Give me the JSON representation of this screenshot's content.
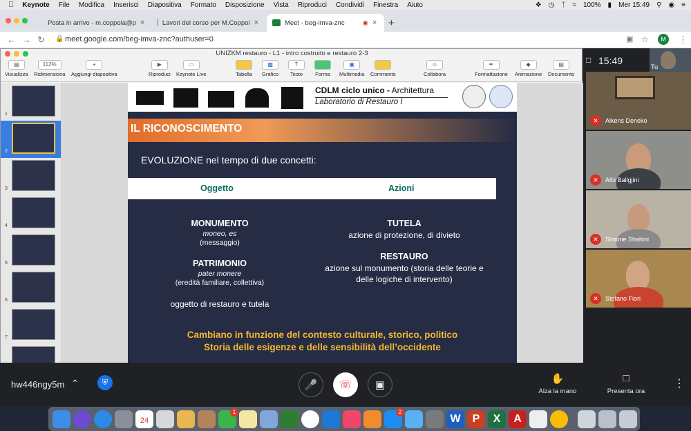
{
  "menubar": {
    "app": "Keynote",
    "items": [
      "File",
      "Modifica",
      "Inserisci",
      "Diapositiva",
      "Formato",
      "Disposizione",
      "Vista",
      "Riproduci",
      "Condividi",
      "Finestra",
      "Aiuto"
    ],
    "battery": "100%",
    "datetime": "Mer 15:49"
  },
  "browser": {
    "tabs": [
      {
        "title": "Posta in arrivo - m.coppola@p",
        "color": "#d93025"
      },
      {
        "title": "Lavori del corso per M.Coppol",
        "color": "#7e57c2"
      },
      {
        "title": "Meet - beg-imva-znc",
        "color": "#188038"
      }
    ],
    "url": "meet.google.com/beg-imva-znc?authuser=0",
    "profile_initial": "M"
  },
  "keynote": {
    "window_title": "UNIZKM restauro - L1 - intro costruito e restauro 2-3",
    "toolbar": {
      "view": "Visualizza",
      "zoom_value": "112%",
      "zoom": "Ridimensiona",
      "add_slide": "Aggiungi diapositiva",
      "play": "Riproduci",
      "keynote_live": "Keynote Live",
      "table": "Tabella",
      "chart": "Grafico",
      "text": "Testo",
      "shape": "Forma",
      "media": "Multimedia",
      "comment": "Commento",
      "collaborate": "Collabora",
      "format": "Formattazione",
      "animate": "Animazione",
      "document": "Documento"
    },
    "thumbnails": [
      "1",
      "2",
      "3",
      "4",
      "5",
      "6",
      "7"
    ],
    "slide": {
      "header_line1_bold": "CDLM ciclo unico -",
      "header_line1_rest": " Architettura",
      "header_line2": "Laboratorio di Restauro I",
      "banner": "IL RICONOSCIMENTO",
      "intro": "EVOLUZIONE nel tempo di due concetti:",
      "col_left": "Oggetto",
      "col_right": "Azioni",
      "monumento": "MONUMENTO",
      "monumento_etym": "moneo, es",
      "monumento_gloss": "(messaggio)",
      "patrimonio": "PATRIMONIO",
      "patrimonio_etym": "pater monere",
      "patrimonio_gloss": "(eredità familiare, collettiva)",
      "oggetto": "oggetto di restauro e tutela",
      "tutela": "TUTELA",
      "tutela_desc": "azione di protezione, di divieto",
      "restauro": "RESTAURO",
      "restauro_desc1": "azione sul monumento (storia delle teorie e",
      "restauro_desc2": "delle logiche di intervento)",
      "footer1": "Cambiano in funzione del contesto culturale, storico, politico",
      "footer2": "Storia delle esigenze e delle sensibilità dell’occidente"
    }
  },
  "meet": {
    "time": "15:49",
    "self_label": "Tu",
    "participants": [
      "Alkens Deneko",
      "Albi Ballgjini",
      "Simone Shahini",
      "Stefano Fiori"
    ],
    "meeting_code": "hw446ngy5m",
    "raise_hand": "Alza la mano",
    "present_now": "Presenta ora"
  },
  "dock": {
    "calendar_day": "24",
    "badges": [
      "1",
      "2"
    ]
  }
}
